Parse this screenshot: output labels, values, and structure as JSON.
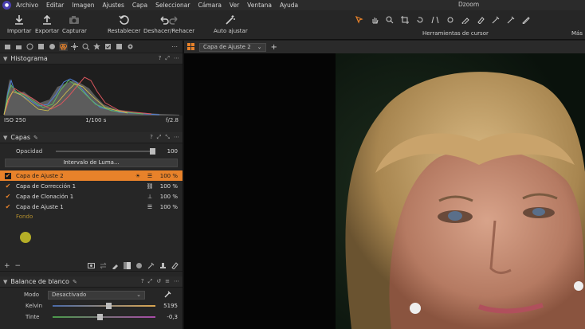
{
  "menu": {
    "items": [
      "Archivo",
      "Editar",
      "Imagen",
      "Ajustes",
      "Capa",
      "Seleccionar",
      "Cámara",
      "Ver",
      "Ventana",
      "Ayuda"
    ],
    "window_title": "Dzoom"
  },
  "toolbar": {
    "importar": "Importar",
    "exportar": "Exportar",
    "capturar": "Capturar",
    "restablecer": "Restablecer",
    "deshacer": "Deshacer/Rehacer",
    "auto": "Auto ajustar",
    "cursor_tools": "Herramientas de cursor",
    "mas": "Más"
  },
  "histogram": {
    "title": "Histograma",
    "iso": "ISO 250",
    "shutter": "1/100 s",
    "aperture": "f/2.8"
  },
  "layers_panel": {
    "title": "Capas",
    "opacity_label": "Opacidad",
    "opacity_value": "100",
    "opacity_fraction": 1.0,
    "luma_button": "Intervalo de Luma...",
    "layers": [
      {
        "name": "Capa de Ajuste 2",
        "pct": "100 %",
        "selected": true,
        "icon": "sliders-icon"
      },
      {
        "name": "Capa de Corrección 1",
        "pct": "100 %",
        "selected": false,
        "icon": "link-icon"
      },
      {
        "name": "Capa de Clonación 1",
        "pct": "100 %",
        "selected": false,
        "icon": "stamp-icon"
      },
      {
        "name": "Capa de Ajuste 1",
        "pct": "100 %",
        "selected": false,
        "icon": "sliders-icon"
      }
    ],
    "background_label": "Fondo"
  },
  "white_balance": {
    "title": "Balance de blanco",
    "mode_label": "Modo",
    "mode_value": "Desactivado",
    "kelvin_label": "Kelvin",
    "kelvin_value": "5195",
    "tint_label": "Tinte",
    "tint_value": "-0,3"
  },
  "viewer": {
    "tab_label": "Capa de Ajuste 2"
  },
  "colors": {
    "accent": "#e8822a",
    "panel": "#262626",
    "viewer_bg": "#050505"
  }
}
